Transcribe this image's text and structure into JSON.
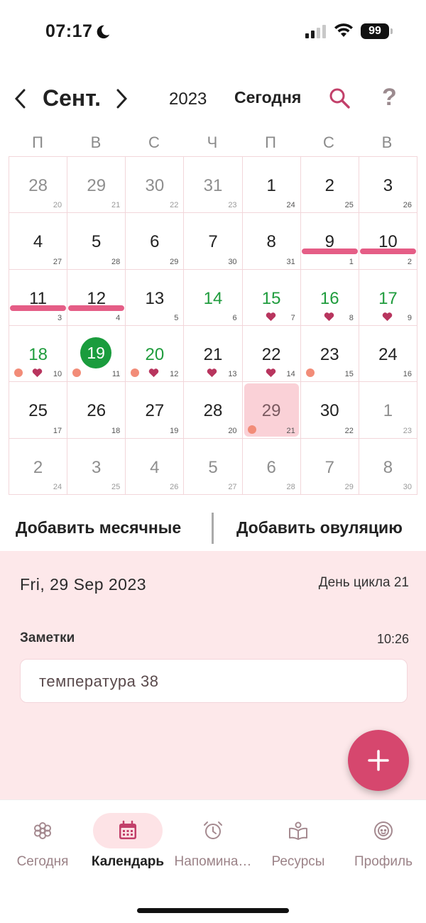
{
  "status_bar": {
    "time": "07:17",
    "battery": "99"
  },
  "header": {
    "month": "Сент.",
    "year": "2023",
    "today_label": "Сегодня"
  },
  "weekdays": [
    "П",
    "В",
    "С",
    "Ч",
    "П",
    "С",
    "В"
  ],
  "calendar": {
    "weeks": [
      [
        {
          "d": "28",
          "c": "20",
          "out": true
        },
        {
          "d": "29",
          "c": "21",
          "out": true
        },
        {
          "d": "30",
          "c": "22",
          "out": true
        },
        {
          "d": "31",
          "c": "23",
          "out": true
        },
        {
          "d": "1",
          "c": "24"
        },
        {
          "d": "2",
          "c": "25"
        },
        {
          "d": "3",
          "c": "26"
        }
      ],
      [
        {
          "d": "4",
          "c": "27"
        },
        {
          "d": "5",
          "c": "28"
        },
        {
          "d": "6",
          "c": "29"
        },
        {
          "d": "7",
          "c": "30"
        },
        {
          "d": "8",
          "c": "31"
        },
        {
          "d": "9",
          "c": "1",
          "period": true
        },
        {
          "d": "10",
          "c": "2",
          "period": true
        }
      ],
      [
        {
          "d": "11",
          "c": "3",
          "period": true
        },
        {
          "d": "12",
          "c": "4",
          "period": true
        },
        {
          "d": "13",
          "c": "5"
        },
        {
          "d": "14",
          "c": "6",
          "fertile": true
        },
        {
          "d": "15",
          "c": "7",
          "fertile": true,
          "heart": true
        },
        {
          "d": "16",
          "c": "8",
          "fertile": true,
          "heart": true
        },
        {
          "d": "17",
          "c": "9",
          "fertile": true,
          "heart": true
        }
      ],
      [
        {
          "d": "18",
          "c": "10",
          "fertile": true,
          "heart": true,
          "dot": true
        },
        {
          "d": "19",
          "c": "11",
          "today": true,
          "dot": true
        },
        {
          "d": "20",
          "c": "12",
          "fertile": true,
          "heart": true,
          "dot": true
        },
        {
          "d": "21",
          "c": "13",
          "heart": true
        },
        {
          "d": "22",
          "c": "14",
          "heart": true
        },
        {
          "d": "23",
          "c": "15",
          "dot": true
        },
        {
          "d": "24",
          "c": "16"
        }
      ],
      [
        {
          "d": "25",
          "c": "17"
        },
        {
          "d": "26",
          "c": "18"
        },
        {
          "d": "27",
          "c": "19"
        },
        {
          "d": "28",
          "c": "20"
        },
        {
          "d": "29",
          "c": "21",
          "selected": true,
          "dot": true
        },
        {
          "d": "30",
          "c": "22"
        },
        {
          "d": "1",
          "c": "23",
          "out": true
        }
      ],
      [
        {
          "d": "2",
          "c": "24",
          "out": true
        },
        {
          "d": "3",
          "c": "25",
          "out": true
        },
        {
          "d": "4",
          "c": "26",
          "out": true
        },
        {
          "d": "5",
          "c": "27",
          "out": true
        },
        {
          "d": "6",
          "c": "28",
          "out": true
        },
        {
          "d": "7",
          "c": "29",
          "out": true
        },
        {
          "d": "8",
          "c": "30",
          "out": true
        }
      ]
    ]
  },
  "actions": {
    "add_period": "Добавить месячные",
    "add_ovulation": "Добавить овуляцию"
  },
  "details": {
    "date": "Fri, 29 Sep 2023",
    "cycle_day": "День цикла 21",
    "notes_label": "Заметки",
    "notes_time": "10:26",
    "note_text": "температура 38"
  },
  "bottom_nav": [
    {
      "label": "Сегодня",
      "icon": "flower-icon",
      "active": false
    },
    {
      "label": "Календарь",
      "icon": "calendar-icon",
      "active": true
    },
    {
      "label": "Напомина…",
      "icon": "alarm-clock-icon",
      "active": false
    },
    {
      "label": "Ресурсы",
      "icon": "book-icon",
      "active": false
    },
    {
      "label": "Профиль",
      "icon": "profile-icon",
      "active": false
    }
  ],
  "colors": {
    "accent": "#d6476e",
    "period": "#e55d86",
    "fertile": "#1f9c3d",
    "panel": "#fde8ea"
  }
}
